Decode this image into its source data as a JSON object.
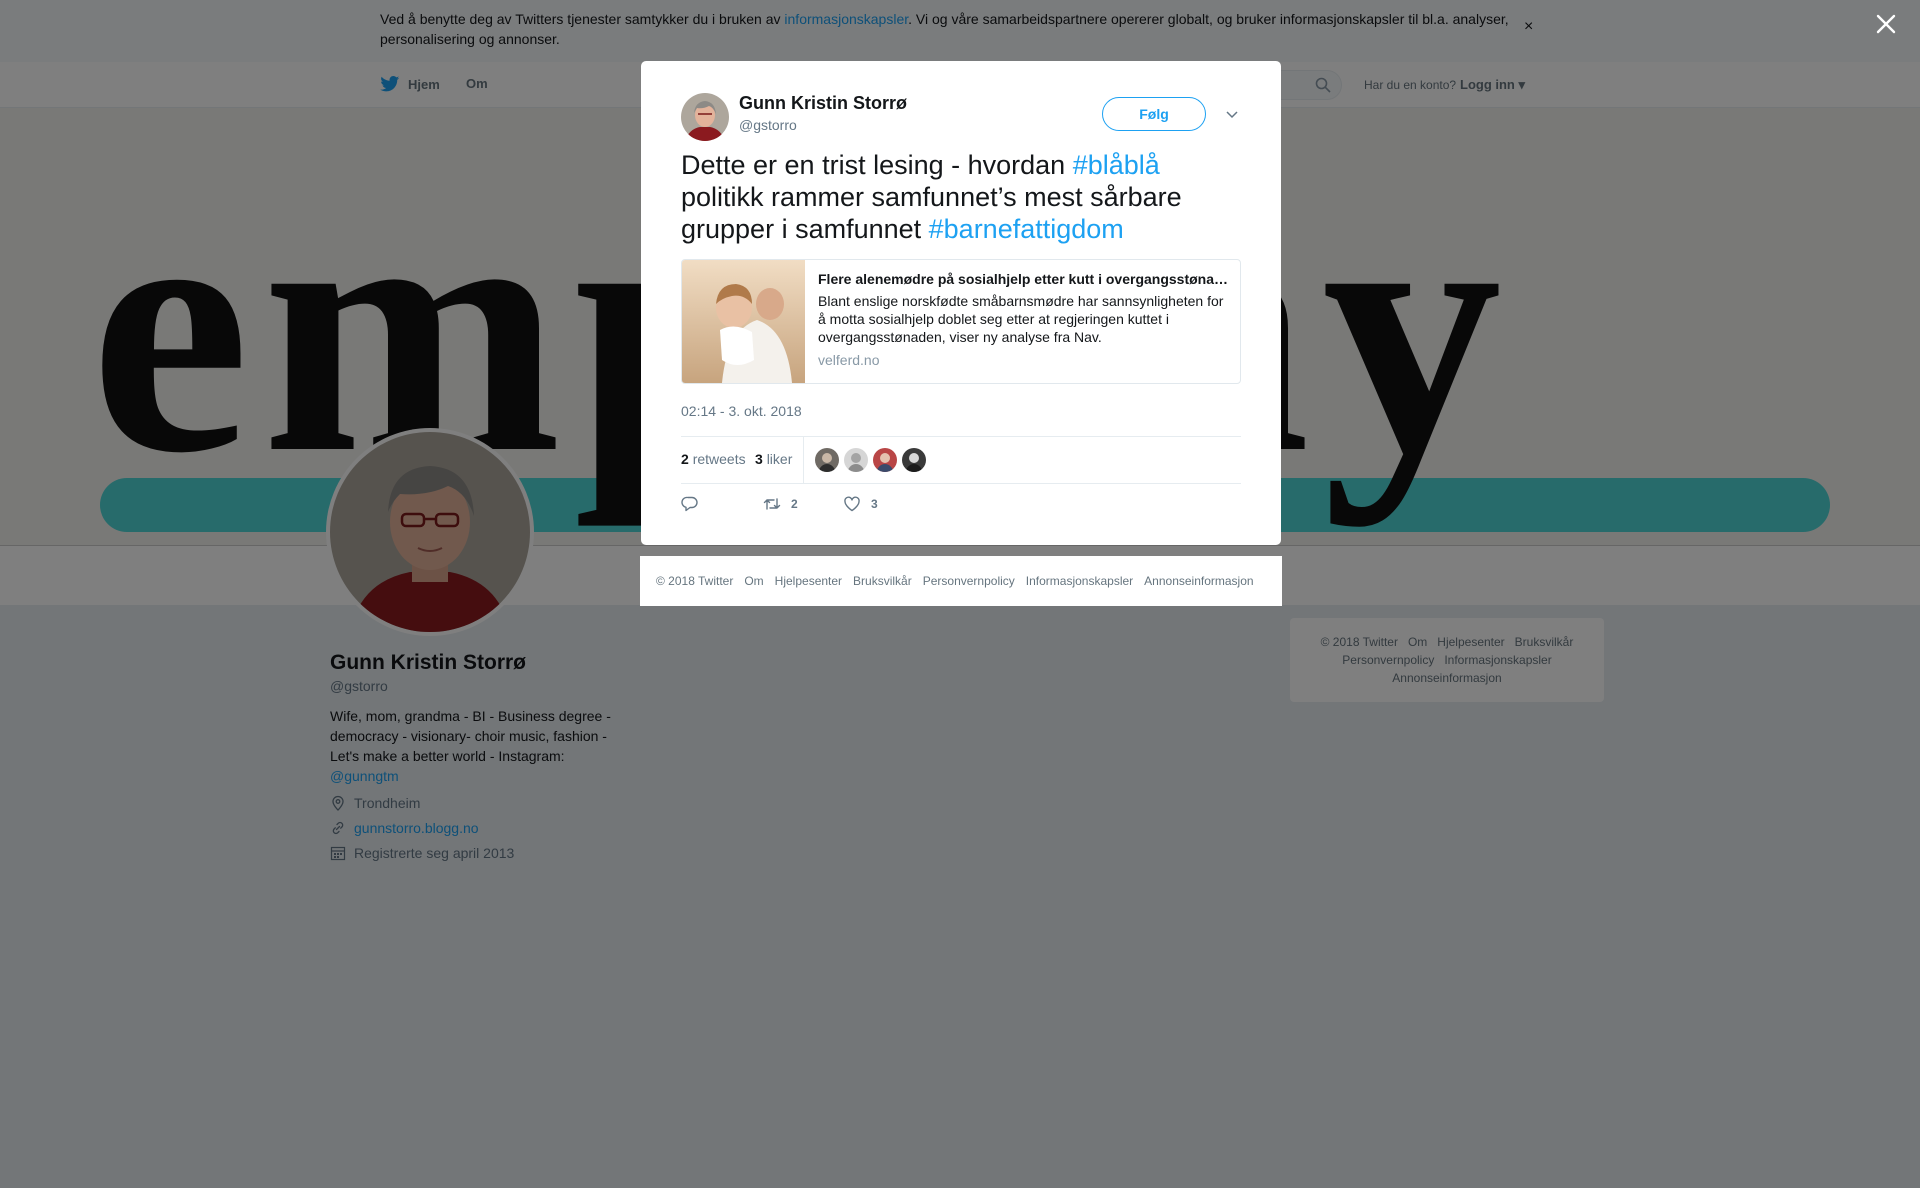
{
  "cookie": {
    "text_before": "Ved å benytte deg av Twitters tjenester samtykker du i bruken av ",
    "link": "informasjonskapsler",
    "text_after": ". Vi og våre samarbeidspartnere opererer globalt, og bruker informasjonskapsler til bl.a. analyser, personalisering og annonser.",
    "close_glyph": "×"
  },
  "topnav": {
    "home": "Hjem",
    "about": "Om",
    "login_question": "Har du en konto?",
    "login_link": "Logg inn"
  },
  "header_photo": {
    "word": "empathy"
  },
  "profile": {
    "name": "Gunn Kristin Storrø",
    "handle": "@gstorro",
    "bio": "Wife, mom, grandma - BI - Business degree - democracy - visionary- choir music, fashion - Let's make a better world - Instagram:",
    "bio_mention": "@gunngtm",
    "location": "Trondheim",
    "website": "gunnstorro.blogg.no",
    "joined": "Registrerte seg april 2013"
  },
  "side_footer": {
    "line1": [
      "© 2018 Twitter",
      "Om",
      "Hjelpesenter",
      "Bruksvilkår"
    ],
    "line2": [
      "Personvernpolicy",
      "Informasjonskapsler"
    ],
    "line3": [
      "Annonseinformasjon"
    ]
  },
  "tweet": {
    "author_name": "Gunn Kristin Storrø",
    "author_handle": "@gstorro",
    "follow_label": "Følg",
    "text_1": "Dette er en trist lesing - hvordan ",
    "tag_1": "#blåblå",
    "text_2": " politikk rammer samfunnet’s mest sårbare grupper i samfunnet ",
    "tag_2": "#barnefattigdom",
    "card": {
      "title": "Flere alenemødre på sosialhjelp etter kutt i overgangsstønaden",
      "description": "Blant enslige norskfødte småbarnsmødre har sannsynligheten for å motta sosialhjelp doblet seg etter at regjeringen kuttet i overgangsstønaden, viser ny analyse fra Nav.",
      "domain": "velferd.no"
    },
    "timestamp": "02:14 - 3. okt. 2018",
    "retweets_count": "2",
    "retweets_label": "retweets",
    "likes_count": "3",
    "likes_label": "liker",
    "action_retweets": "2",
    "action_likes": "3"
  },
  "modal_footer": [
    "© 2018 Twitter",
    "Om",
    "Hjelpesenter",
    "Bruksvilkår",
    "Personvernpolicy",
    "Informasjonskapsler",
    "Annonseinformasjon"
  ],
  "colors": {
    "accent": "#1da1f2",
    "text": "#14171a",
    "muted": "#657786",
    "overlay": "rgba(0,0,0,0.5)"
  }
}
